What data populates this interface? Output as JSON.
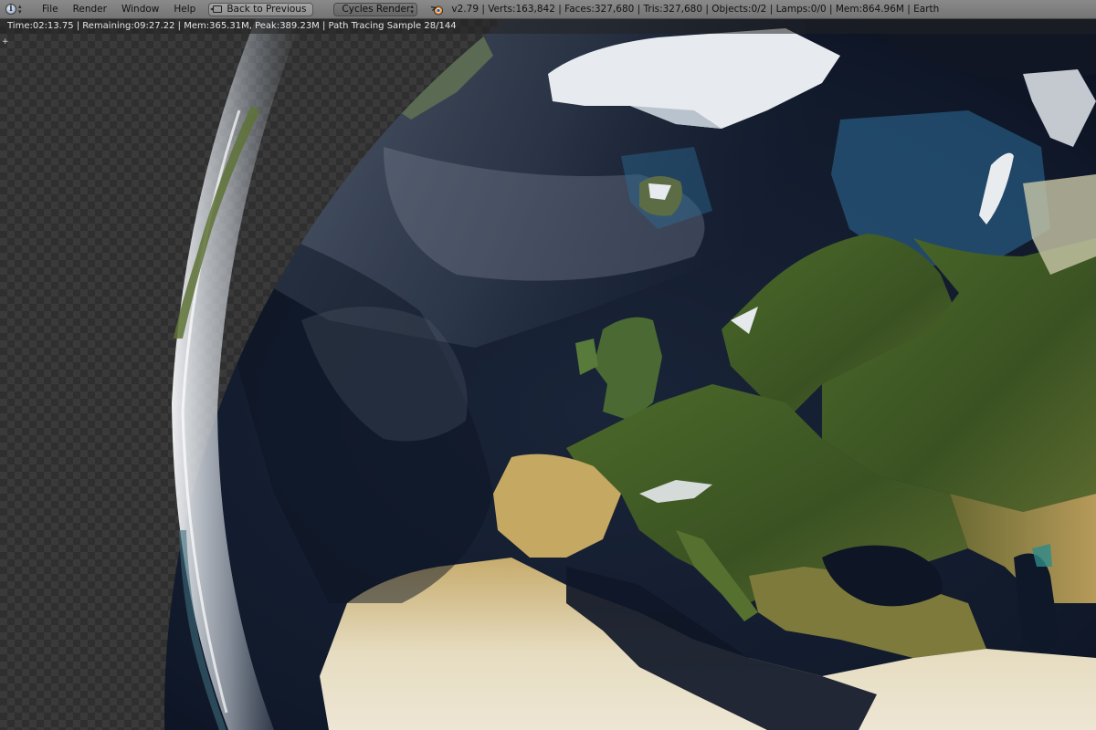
{
  "header": {
    "menu": [
      "File",
      "Render",
      "Window",
      "Help"
    ],
    "back_button": "Back to Previous",
    "render_engine": "Cycles Render",
    "stats": "v2.79 | Verts:163,842 | Faces:327,680 | Tris:327,680 | Objects:0/2 | Lamps:0/0 | Mem:864.96M | Earth"
  },
  "render_info": {
    "text": "Time:02:13.75 | Remaining:09:27.22 | Mem:365.31M, Peak:389.23M | Path Tracing Sample 28/144"
  },
  "icons": {
    "editor_type": "info-icon",
    "back": "back-to-previous-icon",
    "engine_logo": "blender-logo-icon"
  },
  "colors": {
    "header_bg": "#7f7f7f",
    "ocean": "#10182a",
    "land_green": "#3f5624",
    "desert": "#c9b27a",
    "ice": "#e7ebef"
  }
}
